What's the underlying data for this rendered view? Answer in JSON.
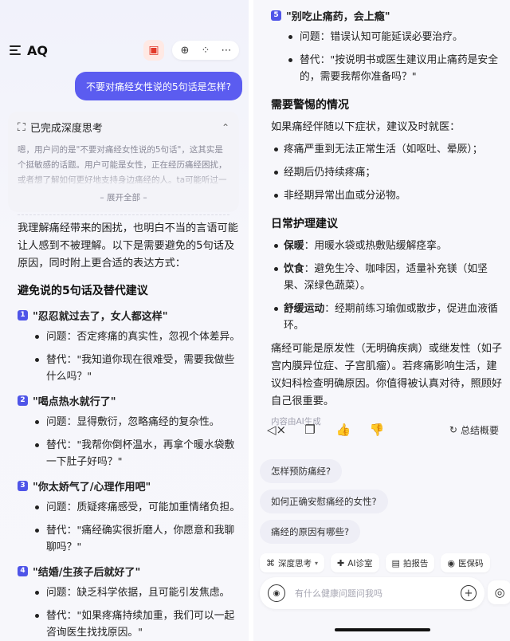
{
  "header": {
    "title": "AQ"
  },
  "user_message": "不要对痛经女性说的5句话是怎样?",
  "thinking": {
    "title": "已完成深度思考",
    "text": "嗯，用户问的是\"不要对痛经女性说的5句话\"，这其实是个挺敏感的话题。用户可能是女性，正在经历痛经困扰，或者想了解如何更好地支持身边痛经的人。ta可能听过一些",
    "expand_label": "– 展开全部 –"
  },
  "intro": "我理解痛经带来的困扰，也明白不当的言语可能让人感到不被理解。以下是需要避免的5句话及原因，同时附上更合适的表达方式：",
  "section_title": "避免说的5句话及替代建议",
  "tips": [
    {
      "num": "1",
      "title": "\"忍忍就过去了，女人都这样\"",
      "problem": "问题：否定疼痛的真实性，忽视个体差异。",
      "alt": "替代：\"我知道你现在很难受，需要我做些什么吗？\""
    },
    {
      "num": "2",
      "title": "\"喝点热水就行了\"",
      "problem": "问题：显得敷衍，忽略痛经的复杂性。",
      "alt": "替代：\"我帮你倒杯温水，再拿个暖水袋敷一下肚子好吗？\""
    },
    {
      "num": "3",
      "title": "\"你太娇气了/心理作用吧\"",
      "problem": "问题：质疑疼痛感受，可能加重情绪负担。",
      "alt": "替代：\"痛经确实很折磨人，你愿意和我聊聊吗？\""
    },
    {
      "num": "4",
      "title": "\"结婚/生孩子后就好了\"",
      "problem": "问题：缺乏科学依据，且可能引发焦虑。",
      "alt": "替代：\"如果疼痛持续加重，我们可以一起咨询医生找找原因。\""
    },
    {
      "num": "5",
      "title": "\"别吃止痛药，会上瘾\"",
      "problem": "问题：错误认知可能延误必要治疗。",
      "alt": "替代：\"按说明书或医生建议用止痛药是安全的，需要我帮你准备吗？\""
    }
  ],
  "warning": {
    "title": "需要警惕的情况",
    "intro": "如果痛经伴随以下症状，建议及时就医：",
    "items": [
      "疼痛严重到无法正常生活（如呕吐、晕厥）；",
      "经期后仍持续疼痛；",
      "非经期异常出血或分泌物。"
    ]
  },
  "care": {
    "title": "日常护理建议",
    "items": [
      {
        "label": "保暖",
        "text": "：用暖水袋或热敷贴缓解痉挛。"
      },
      {
        "label": "饮食",
        "text": "：避免生冷、咖啡因，适量补充镁（如坚果、深绿色蔬菜）。"
      },
      {
        "label": "舒缓运动",
        "text": "：经期前练习瑜伽或散步，促进血液循环。"
      }
    ]
  },
  "closing": "痛经可能是原发性（无明确疾病）或继发性（如子宫内膜异位症、子宫肌瘤）。若疼痛影响生活，建议妇科检查明确原因。你值得被认真对待，照顾好自己很重要。",
  "ai_note": "内容由AI生成",
  "actions": {
    "summary_label": "总结概要"
  },
  "suggestions": [
    "怎样预防痛经?",
    "如何正确安慰痛经的女性?",
    "痛经的原因有哪些?"
  ],
  "tools": [
    {
      "icon": "⌘",
      "label": "深度思考",
      "dropdown": "▾"
    },
    {
      "icon": "✚",
      "label": "AI诊室"
    },
    {
      "icon": "▤",
      "label": "拍报告"
    },
    {
      "icon": "◉",
      "label": "医保码"
    }
  ],
  "input": {
    "placeholder": "有什么健康问题问我吗"
  }
}
